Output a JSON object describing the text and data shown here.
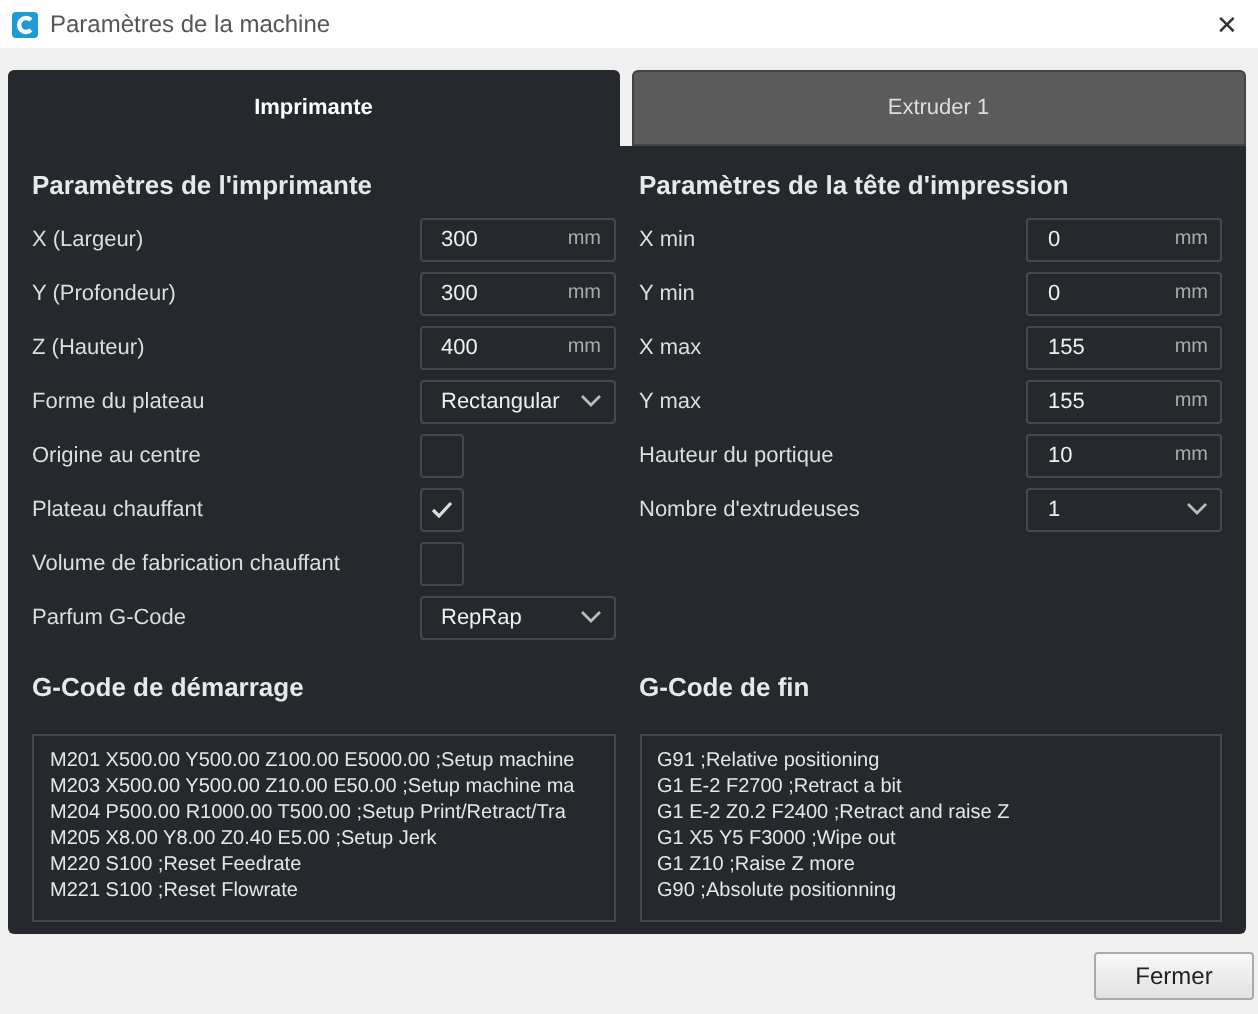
{
  "window": {
    "title": "Paramètres de la machine",
    "close": "✕"
  },
  "tabs": [
    {
      "label": "Imprimante",
      "selected": true
    },
    {
      "label": "Extruder 1",
      "selected": false
    }
  ],
  "printer_settings": {
    "heading": "Paramètres de l'imprimante",
    "rows": [
      {
        "kind": "number",
        "label": "X (Largeur)",
        "value": "300",
        "unit": "mm"
      },
      {
        "kind": "number",
        "label": "Y (Profondeur)",
        "value": "300",
        "unit": "mm"
      },
      {
        "kind": "number",
        "label": "Z (Hauteur)",
        "value": "400",
        "unit": "mm"
      },
      {
        "kind": "dropdown",
        "label": "Forme du plateau",
        "value": "Rectangular"
      },
      {
        "kind": "checkbox",
        "label": "Origine au centre",
        "checked": false
      },
      {
        "kind": "checkbox",
        "label": "Plateau chauffant",
        "checked": true
      },
      {
        "kind": "checkbox",
        "label": "Volume de fabrication chauffant",
        "checked": false
      },
      {
        "kind": "dropdown",
        "label": "Parfum G-Code",
        "value": "RepRap"
      }
    ]
  },
  "printhead_settings": {
    "heading": "Paramètres de la tête d'impression",
    "rows": [
      {
        "kind": "number",
        "label": "X min",
        "value": "0",
        "unit": "mm"
      },
      {
        "kind": "number",
        "label": "Y min",
        "value": "0",
        "unit": "mm"
      },
      {
        "kind": "number",
        "label": "X max",
        "value": "155",
        "unit": "mm"
      },
      {
        "kind": "number",
        "label": "Y max",
        "value": "155",
        "unit": "mm"
      },
      {
        "kind": "number",
        "label": "Hauteur du portique",
        "value": "10",
        "unit": "mm"
      },
      {
        "kind": "dropdown",
        "label": "Nombre d'extrudeuses",
        "value": "1"
      }
    ]
  },
  "start_gcode": {
    "heading": "G-Code de démarrage",
    "lines": [
      "M201 X500.00 Y500.00 Z100.00 E5000.00 ;Setup machine",
      "M203 X500.00 Y500.00 Z10.00 E50.00 ;Setup machine ma",
      "M204 P500.00 R1000.00 T500.00 ;Setup Print/Retract/Tra",
      "M205 X8.00 Y8.00 Z0.40 E5.00 ;Setup Jerk",
      "M220 S100 ;Reset Feedrate",
      "M221 S100 ;Reset Flowrate"
    ]
  },
  "end_gcode": {
    "heading": "G-Code de fin",
    "lines": [
      "G91 ;Relative positioning",
      "G1 E-2 F2700 ;Retract a bit",
      "G1 E-2 Z0.2 F2400 ;Retract and raise Z",
      "G1 X5 Y5 F3000 ;Wipe out",
      "G1 Z10 ;Raise Z more",
      "G90 ;Absolute positionning"
    ]
  },
  "buttons": [
    "Fermer"
  ]
}
